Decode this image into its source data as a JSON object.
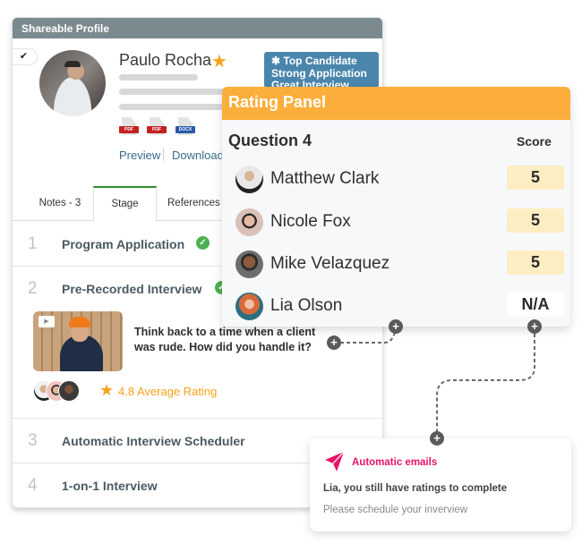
{
  "profile": {
    "header_title": "Shareable Profile",
    "check_glyph": "✔",
    "candidate_name": "Paulo Rocha",
    "star_glyph": "★",
    "tags": [
      "✱ Top Candidate",
      "Strong Application",
      "Great Interview"
    ],
    "files": [
      {
        "type": "PDF",
        "color": "#c4201f"
      },
      {
        "type": "PDF",
        "color": "#c4201f"
      },
      {
        "type": "DOCX",
        "color": "#2a5aa8"
      }
    ],
    "preview_label": "Preview",
    "download_label": "Download",
    "tabs": [
      {
        "label": "Notes - 3",
        "active": false
      },
      {
        "label": "Stage",
        "active": true
      },
      {
        "label": "References",
        "active": false
      }
    ],
    "stages": [
      {
        "number": "1",
        "title": "Program Application",
        "completed": true
      },
      {
        "number": "2",
        "title": "Pre-Recorded Interview",
        "completed": true
      },
      {
        "number": "3",
        "title": "Automatic Interview Scheduler",
        "completed": false
      },
      {
        "number": "4",
        "title": "1-on-1 Interview",
        "completed": false
      }
    ],
    "video_question": "Think back to a time when a client was rude. How did you handle it?",
    "play_glyph": "▶",
    "average_rating_label": "4.8 Average Rating",
    "average_rating_value": 4.8
  },
  "rating_panel": {
    "title": "Rating Panel",
    "question": "Question 4",
    "score_header": "Score",
    "raters": [
      {
        "name": "Matthew Clark",
        "score": "5"
      },
      {
        "name": "Nicole Fox",
        "score": "5"
      },
      {
        "name": "Mike Velazquez",
        "score": "5"
      },
      {
        "name": "Lia Olson",
        "score": "N/A"
      }
    ]
  },
  "connector": {
    "plus_glyph": "+"
  },
  "email_card": {
    "title": "Automatic emails",
    "subject": "Lia, you still have ratings to complete",
    "body": "Please schedule your inverview"
  },
  "colors": {
    "profile_header": "#7b8a8e",
    "rating_header": "#fbae3c",
    "score_fill": "#fdedc2",
    "tag_blue": "#4a86ac",
    "success_green": "#4caf50",
    "star_orange": "#f7a21b",
    "email_pink": "#e8146c",
    "link_blue": "#3a6c8a"
  }
}
